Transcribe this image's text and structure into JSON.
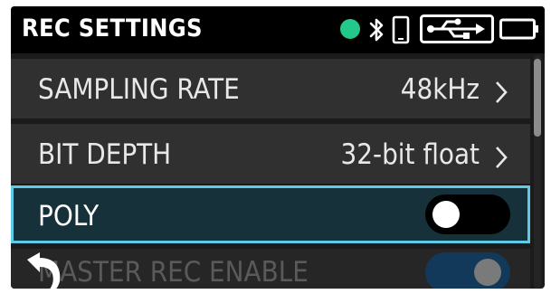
{
  "header": {
    "title": "REC SETTINGS",
    "status_color": "#22c98a",
    "icons": [
      "status-dot",
      "bluetooth-icon",
      "phone-icon",
      "usb-icon",
      "battery-icon"
    ]
  },
  "menu": {
    "items": [
      {
        "label": "SAMPLING RATE",
        "value": "48kHz",
        "control": "chevron"
      },
      {
        "label": "BIT DEPTH",
        "value": "32-bit float",
        "control": "chevron"
      },
      {
        "label": "POLY",
        "control": "toggle",
        "state": "off",
        "selected": true
      },
      {
        "label": "MASTER REC ENABLE",
        "control": "toggle",
        "state": "on",
        "enabled": false
      }
    ]
  },
  "scroll": {
    "position": "top"
  },
  "back_icon": "back-arrow-icon",
  "colors": {
    "highlight_border": "#5ecbe6",
    "highlight_bg": "#16313a",
    "row_bg": "#303030",
    "toggle_on_bg": "#12395a"
  }
}
